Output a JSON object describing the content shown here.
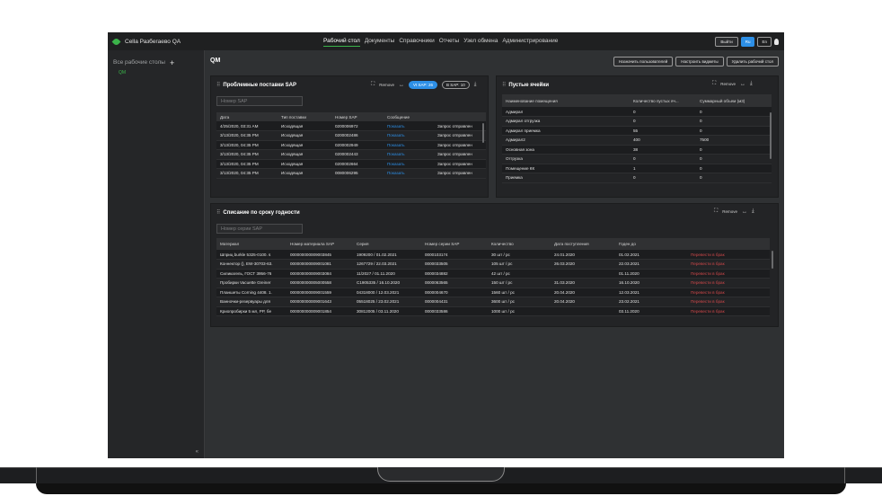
{
  "app": {
    "title": "Cella Разбегаево QA"
  },
  "nav": [
    "Рабочий стол",
    "Документы",
    "Справочники",
    "Отчеты",
    "Узел обмена",
    "Администрирование"
  ],
  "nav_active": "Рабочий стол",
  "topbar": {
    "logout": "Выйти",
    "lang_ru": "Ru",
    "lang_en": "En"
  },
  "sidebar": {
    "title": "Все рабочие столы",
    "item": "QM",
    "collapse": "«"
  },
  "main": {
    "title": "QM",
    "actions": [
      "Назначить пользователей",
      "Настроить виджеты",
      "Удалить рабочий стол"
    ]
  },
  "widget_supplies": {
    "title": "Проблемные поставки SAP",
    "remove": "Remove",
    "pill1": "Vt SAP: 26",
    "pill2": "В SAP: 10",
    "search_placeholder": "Номер SAP",
    "columns": [
      "Дата",
      "Тип поставки",
      "Номер SAP",
      "Сообщение",
      ""
    ],
    "rows": [
      [
        "4/25/2020, 03:31 AM",
        "Исходящая",
        "0200006972",
        "Показать",
        "Запрос отправлен"
      ],
      [
        "3/13/2020, 04:35 PM",
        "Исходящая",
        "0200002486",
        "Показать",
        "Запрос отправлен"
      ],
      [
        "3/13/2020, 04:35 PM",
        "Исходящая",
        "0200002949",
        "Показать",
        "Запрос отправлен"
      ],
      [
        "3/13/2020, 04:35 PM",
        "Исходящая",
        "0200002443",
        "Показать",
        "Запрос отправлен"
      ],
      [
        "3/13/2020, 04:35 PM",
        "Исходящая",
        "0200002664",
        "Показать",
        "Запрос отправлен"
      ],
      [
        "3/13/2020, 04:35 PM",
        "Исходящая",
        "0080006295",
        "Показать",
        "Запрос отправлен"
      ]
    ]
  },
  "widget_cells": {
    "title": "Пустые ячейки",
    "remove": "Remove",
    "columns": [
      "Наименование помещения",
      "Количество пустых яч...",
      "Суммарный объем (м3)"
    ],
    "rows": [
      [
        "Адмирал",
        "0",
        "0"
      ],
      [
        "Адмирал отгрузка",
        "0",
        "0"
      ],
      [
        "Адмирал приемка",
        "55",
        "0"
      ],
      [
        "Адмирал2",
        "400",
        "7500"
      ],
      [
        "Основная зона",
        "38",
        "0"
      ],
      [
        "Отгрузка",
        "0",
        "0"
      ],
      [
        "Помещение КК",
        "1",
        "0"
      ],
      [
        "Приемка",
        "0",
        "0"
      ]
    ]
  },
  "widget_expiry": {
    "title": "Списание по сроку годности",
    "remove": "Remove",
    "search_placeholder": "Номер серии SAP",
    "columns": [
      "Материал",
      "Номер материала SAP",
      "Серия",
      "Номер серии SAP",
      "Количество",
      "Дата поступления",
      "Годен до",
      ""
    ],
    "rows": [
      [
        "Шприц burkle 5325-0100. s",
        "000000000009003845",
        "1909200 / 01.02.2021",
        "0000103174",
        "30 шт / pc",
        "24.01.2020",
        "01.02.2021",
        "Перевести в брак"
      ],
      [
        "Коннектор (), EW-30703-63.",
        "000000000009001081",
        "1267729 / 22.03.2021",
        "0000033505",
        "105 шт / pc",
        "26.03.2020",
        "22.03.2021",
        "Перевести в брак"
      ],
      [
        "Силикагель, ГОСТ 3956-76",
        "000000000009003084",
        "11/2027 / 01.11.2020",
        "0000034882",
        "42 шт / pc",
        "",
        "01.11.2020",
        "Перевести в брак"
      ],
      [
        "Пробирки Vacuette Greiner",
        "000000000005000558",
        "С1905335 / 16.10.2020",
        "0000063565",
        "150 шт / pc",
        "31.03.2020",
        "16.10.2020",
        "Перевести в брак"
      ],
      [
        "Планшеты Corning 4408. 1.",
        "000000000009001559",
        "04318000 / 12.03.2021",
        "0000004670",
        "1560 шт / pc",
        "20.04.2020",
        "12.03.2021",
        "Перевести в брак"
      ],
      [
        "Ванночки-резервуары для",
        "000000000009001643",
        "05518025 / 23.02.2021",
        "0000004431",
        "3600 шт / pc",
        "20.04.2020",
        "23.02.2021",
        "Перевести в брак"
      ],
      [
        "Криопробирки 5 мл, PP, бе",
        "000000000009001854",
        "30812005 / 03.11.2020",
        "0000033586",
        "1000 шт / pc",
        "",
        "03.11.2020",
        "Перевести в брак"
      ]
    ]
  }
}
